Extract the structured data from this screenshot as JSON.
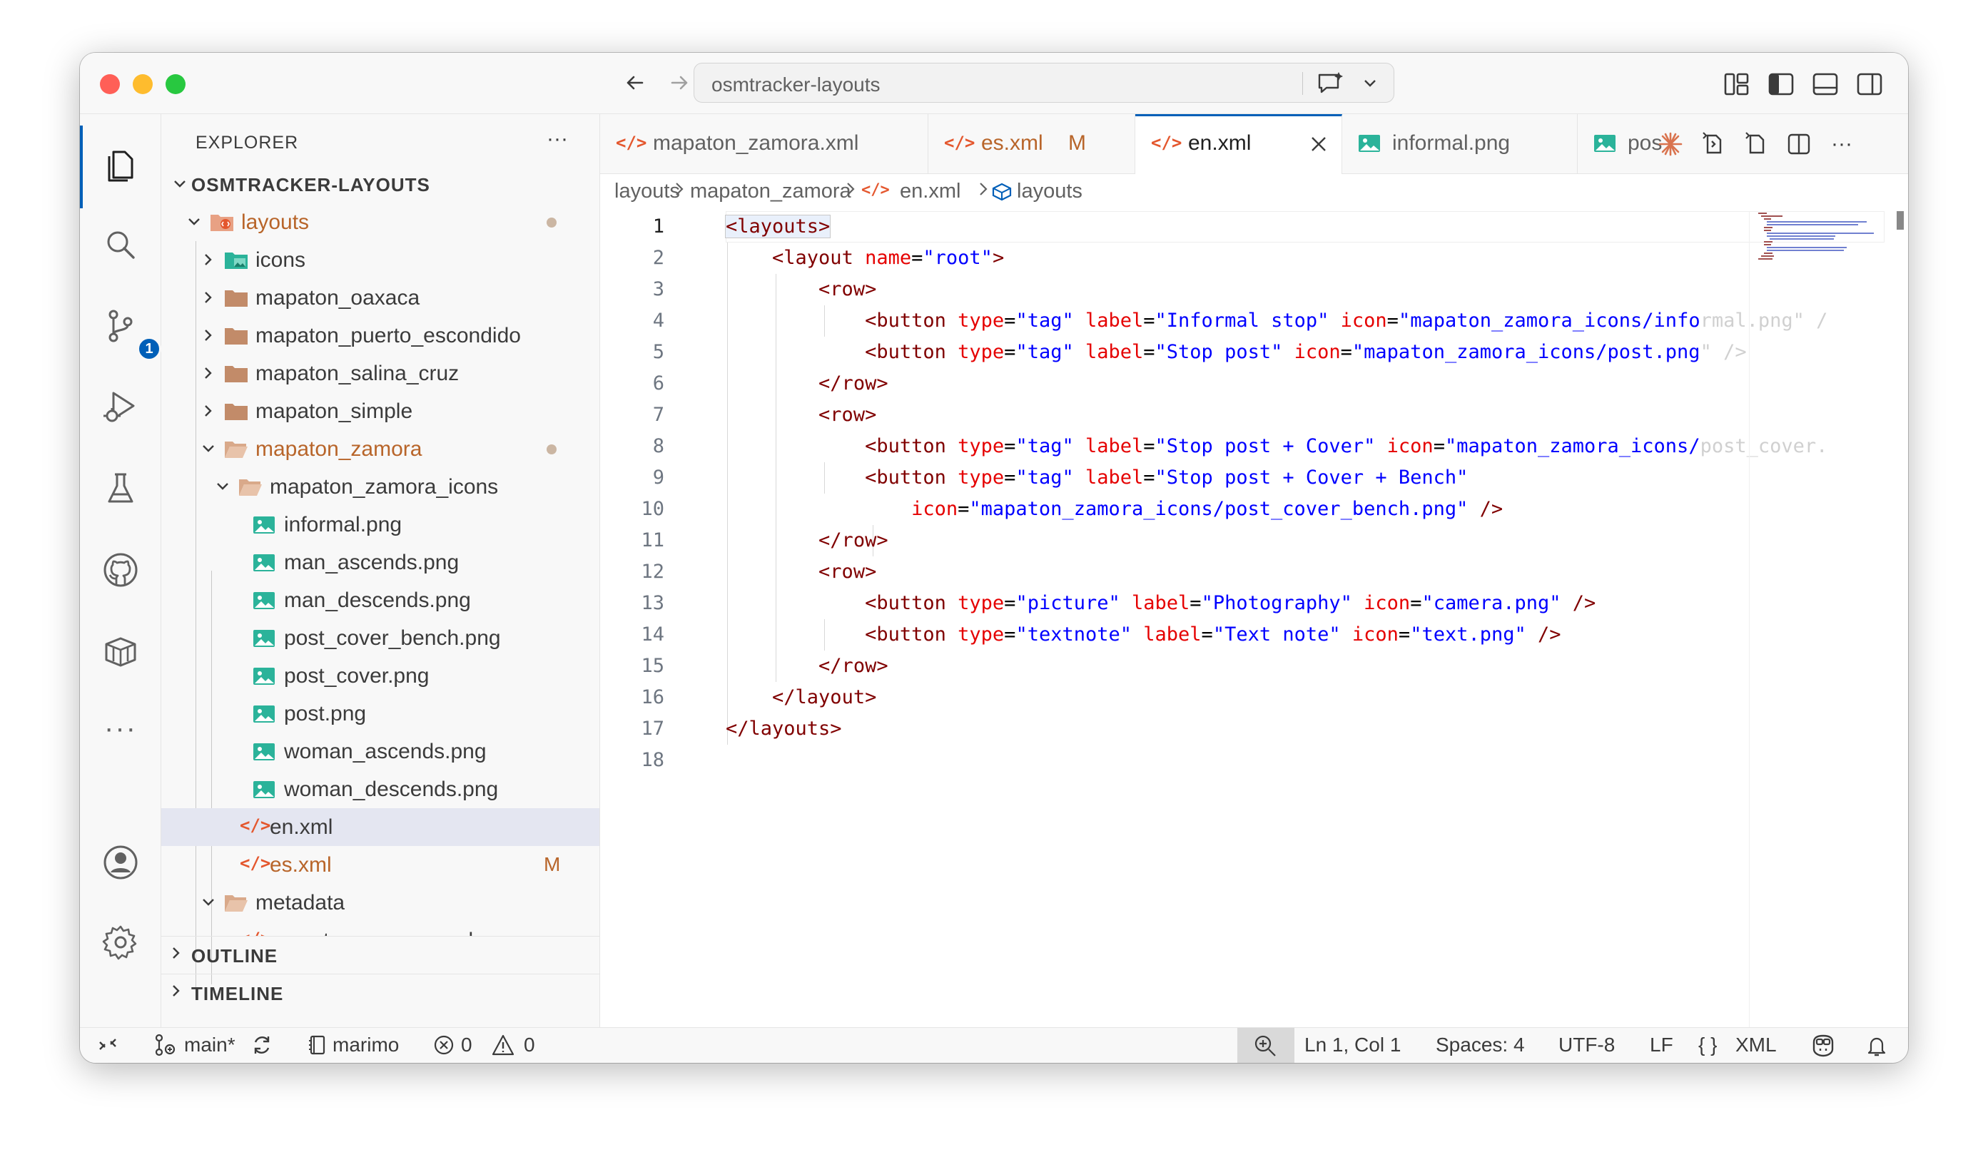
{
  "window": {
    "search_text": "osmtracker-layouts"
  },
  "activity_bar": {
    "items": [
      "explorer-icon",
      "search-icon",
      "source-control-icon",
      "run-debug-icon",
      "testing-icon",
      "github-icon",
      "extensions-icon",
      "more-icon",
      "accounts-icon",
      "settings-gear-icon"
    ],
    "source_control_badge": "1"
  },
  "sidebar": {
    "title": "EXPLORER",
    "more": "···",
    "root": "OSMTRACKER-LAYOUTS",
    "tree": [
      {
        "label": "layouts",
        "modified_dot": true
      },
      {
        "label": "icons"
      },
      {
        "label": "mapaton_oaxaca"
      },
      {
        "label": "mapaton_puerto_escondido"
      },
      {
        "label": "mapaton_salina_cruz"
      },
      {
        "label": "mapaton_simple"
      },
      {
        "label": "mapaton_zamora",
        "modified_dot": true
      },
      {
        "label": "mapaton_zamora_icons"
      },
      {
        "label": "informal.png"
      },
      {
        "label": "man_ascends.png"
      },
      {
        "label": "man_descends.png"
      },
      {
        "label": "post_cover_bench.png"
      },
      {
        "label": "post_cover.png"
      },
      {
        "label": "post.png"
      },
      {
        "label": "woman_ascends.png"
      },
      {
        "label": "woman_descends.png"
      },
      {
        "label": "en.xml",
        "selected": true
      },
      {
        "label": "es.xml",
        "git_status": "M"
      },
      {
        "label": "metadata"
      },
      {
        "label": "mapaton_oaxaca.xml"
      }
    ],
    "outline": "OUTLINE",
    "timeline": "TIMELINE"
  },
  "tabs": [
    {
      "label": "mapaton_zamora.xml"
    },
    {
      "label": "es.xml",
      "status": "M"
    },
    {
      "label": "en.xml",
      "active": true
    },
    {
      "label": "informal.png"
    },
    {
      "label": "pos"
    }
  ],
  "breadcrumb": [
    "layouts",
    "mapaton_zamora",
    "en.xml",
    "layouts"
  ],
  "editor": {
    "line_numbers": [
      "1",
      "2",
      "3",
      "4",
      "5",
      "6",
      "7",
      "8",
      "9",
      "10",
      "11",
      "12",
      "13",
      "14",
      "15",
      "16",
      "17",
      "18"
    ],
    "current_line": "1"
  },
  "status_bar": {
    "branch": "main*",
    "interpreter": "marimo",
    "errors": "0",
    "warnings": "0",
    "position": "Ln 1, Col 1",
    "indent": "Spaces: 4",
    "encoding": "UTF-8",
    "eol": "LF",
    "language": "XML",
    "language_icon": "{ }"
  },
  "colors": {
    "accent": "#005fb8",
    "tag": "#800000",
    "attribute": "#e50000",
    "string": "#0000ff",
    "xml_icon": "#e4572e",
    "modified": "#b8652a"
  }
}
